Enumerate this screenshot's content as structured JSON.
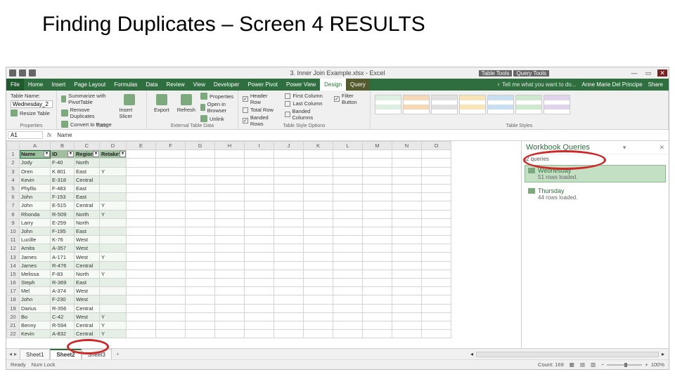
{
  "slide_title": "Finding Duplicates – Screen 4 RESULTS",
  "titlebar": {
    "file_title": "3. Inner Join Example.xlsx - Excel",
    "context_tabs": [
      "Table Tools",
      "Query Tools"
    ],
    "window": {
      "minimize": "—",
      "restore": "▭",
      "close": "✕"
    }
  },
  "tabs": {
    "items": [
      {
        "label": "File",
        "kind": "file"
      },
      {
        "label": "Home"
      },
      {
        "label": "Insert"
      },
      {
        "label": "Page Layout"
      },
      {
        "label": "Formulas"
      },
      {
        "label": "Data"
      },
      {
        "label": "Review"
      },
      {
        "label": "View"
      },
      {
        "label": "Developer"
      },
      {
        "label": "Power Pivot"
      },
      {
        "label": "Power View"
      },
      {
        "label": "Design",
        "kind": "ctx",
        "active": true
      },
      {
        "label": "Query",
        "kind": "ctx"
      }
    ],
    "tell_me": "Tell me what you want to do...",
    "user": "Anne Marie Del Principe",
    "share": "Share"
  },
  "ribbon": {
    "properties": {
      "table_name_label": "Table Name:",
      "table_name_value": "Wednesday_2",
      "resize": "Resize Table",
      "group": "Properties"
    },
    "tools": {
      "pivot": "Summarize with PivotTable",
      "dup": "Remove Duplicates",
      "range": "Convert to Range",
      "slicer": "Insert Slicer",
      "group": "Tools"
    },
    "external": {
      "export": "Export",
      "refresh": "Refresh",
      "props": "Properties",
      "browser": "Open in Browser",
      "unlink": "Unlink",
      "group": "External Table Data"
    },
    "options": {
      "header": "Header Row",
      "total": "Total Row",
      "banded_r": "Banded Rows",
      "first_c": "First Column",
      "last_c": "Last Column",
      "banded_c": "Banded Columns",
      "filter": "Filter Button",
      "group": "Table Style Options"
    },
    "styles": {
      "group": "Table Styles"
    }
  },
  "fbar": {
    "namebox": "A1",
    "fx": "fx",
    "content": "Name"
  },
  "headers": {
    "cols": [
      "A",
      "B",
      "C",
      "D",
      "E",
      "F",
      "G",
      "H",
      "I",
      "J",
      "K",
      "L",
      "M",
      "N",
      "O"
    ]
  },
  "table": {
    "columns": [
      "Name",
      "ID",
      "Region",
      "Retake?"
    ],
    "rows": [
      {
        "n": "Jody",
        "id": "F-40",
        "r": "North",
        "rt": ""
      },
      {
        "n": "Oren",
        "id": "K 801",
        "r": "East",
        "rt": "Y"
      },
      {
        "n": "Kevin",
        "id": "E-318",
        "r": "Central",
        "rt": ""
      },
      {
        "n": "Phyllis",
        "id": "F-483",
        "r": "East",
        "rt": ""
      },
      {
        "n": "John",
        "id": "F-153",
        "r": "East",
        "rt": ""
      },
      {
        "n": "John",
        "id": "E-515",
        "r": "Central",
        "rt": "Y"
      },
      {
        "n": "Rhonda",
        "id": "R-509",
        "r": "North",
        "rt": "Y"
      },
      {
        "n": "Larry",
        "id": "E-259",
        "r": "North",
        "rt": ""
      },
      {
        "n": "John",
        "id": "F-195",
        "r": "East",
        "rt": ""
      },
      {
        "n": "Lucille",
        "id": "K-76",
        "r": "West",
        "rt": ""
      },
      {
        "n": "Amita",
        "id": "A-357",
        "r": "West",
        "rt": ""
      },
      {
        "n": "James",
        "id": "A-171",
        "r": "West",
        "rt": "Y"
      },
      {
        "n": "James",
        "id": "R-476",
        "r": "Central",
        "rt": ""
      },
      {
        "n": "Melissa",
        "id": "F-83",
        "r": "North",
        "rt": "Y"
      },
      {
        "n": "Steph",
        "id": "R-369",
        "r": "East",
        "rt": ""
      },
      {
        "n": "Mel",
        "id": "A-374",
        "r": "West",
        "rt": ""
      },
      {
        "n": "John",
        "id": "F-230",
        "r": "West",
        "rt": ""
      },
      {
        "n": "Darius",
        "id": "R-356",
        "r": "Central",
        "rt": ""
      },
      {
        "n": "Bo",
        "id": "C-42",
        "r": "West",
        "rt": "Y"
      },
      {
        "n": "Benny",
        "id": "R-594",
        "r": "Central",
        "rt": "Y"
      },
      {
        "n": "Kevin",
        "id": "A-832",
        "r": "Central",
        "rt": "Y"
      }
    ]
  },
  "queries": {
    "title": "Workbook Queries",
    "count_label": "2 queries",
    "items": [
      {
        "name": "Wednesday",
        "status": "51 rows loaded.",
        "selected": true
      },
      {
        "name": "Thursday",
        "status": "44 rows loaded.",
        "selected": false
      }
    ]
  },
  "sheets": {
    "tabs": [
      {
        "name": "Sheet1"
      },
      {
        "name": "Sheet2",
        "active": true
      },
      {
        "name": "Sheet3"
      }
    ],
    "add": "+"
  },
  "status": {
    "ready": "Ready",
    "numlock": "Num Lock",
    "count": "Count: 169",
    "zoom": "100%"
  }
}
